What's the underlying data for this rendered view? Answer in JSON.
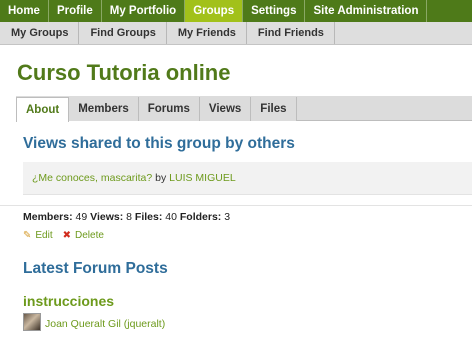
{
  "topnav": {
    "items": [
      {
        "label": "Home"
      },
      {
        "label": "Profile"
      },
      {
        "label": "My Portfolio"
      },
      {
        "label": "Groups",
        "active": true
      },
      {
        "label": "Settings"
      },
      {
        "label": "Site Administration"
      }
    ]
  },
  "subnav": {
    "items": [
      {
        "label": "My Groups"
      },
      {
        "label": "Find Groups"
      },
      {
        "label": "My Friends"
      },
      {
        "label": "Find Friends"
      }
    ]
  },
  "group": {
    "title": "Curso Tutoria online"
  },
  "tabs": [
    {
      "label": "About",
      "active": true
    },
    {
      "label": "Members"
    },
    {
      "label": "Forums"
    },
    {
      "label": "Views"
    },
    {
      "label": "Files"
    }
  ],
  "views_shared": {
    "heading": "Views shared to this group by others",
    "item": {
      "view_title": "¿Me conoces, mascarita?",
      "by": "by",
      "owner": "LUIS MIGUEL"
    }
  },
  "stats": {
    "members_label": "Members:",
    "members": "49",
    "views_label": "Views:",
    "views": "8",
    "files_label": "Files:",
    "files": "40",
    "folders_label": "Folders:",
    "folders": "3"
  },
  "actions": {
    "edit": "Edit",
    "delete": "Delete"
  },
  "forum": {
    "heading": "Latest Forum Posts",
    "topic": "instrucciones",
    "poster": "Joan Queralt Gil (jqueralt)"
  },
  "colors": {
    "nav_green": "#4e7a19",
    "active_tab_green": "#a2c11a",
    "title_green": "#517a1a",
    "link_green": "#6d9a1c",
    "heading_blue": "#2f6d9a"
  }
}
